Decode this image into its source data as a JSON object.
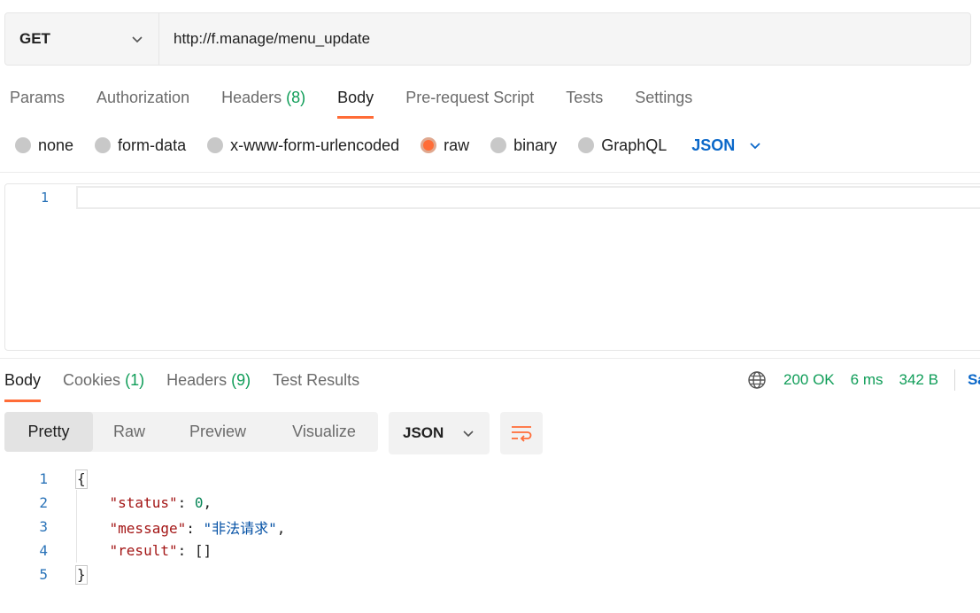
{
  "request": {
    "method": "GET",
    "url": "http://f.manage/menu_update"
  },
  "request_tabs": [
    {
      "label": "Params"
    },
    {
      "label": "Authorization"
    },
    {
      "label": "Headers",
      "count": "(8)"
    },
    {
      "label": "Body",
      "active": true
    },
    {
      "label": "Pre-request Script"
    },
    {
      "label": "Tests"
    },
    {
      "label": "Settings"
    }
  ],
  "body_types": {
    "none": "none",
    "form_data": "form-data",
    "urlencoded": "x-www-form-urlencoded",
    "raw": "raw",
    "binary": "binary",
    "graphql": "GraphQL",
    "format": "JSON",
    "selected": "raw"
  },
  "editor": {
    "line_number": "1"
  },
  "response_tabs": {
    "body": "Body",
    "cookies": "Cookies",
    "cookies_count": "(1)",
    "headers": "Headers",
    "headers_count": "(9)",
    "test_results": "Test Results"
  },
  "response_status": {
    "status": "200 OK",
    "time": "6 ms",
    "size": "342 B",
    "save_label": "Sa"
  },
  "view_modes": {
    "pretty": "Pretty",
    "raw": "Raw",
    "preview": "Preview",
    "visualize": "Visualize",
    "format": "JSON"
  },
  "response_body": {
    "line_numbers": [
      "1",
      "2",
      "3",
      "4",
      "5"
    ],
    "open_brace": "{",
    "close_brace": "}",
    "status_key": "\"status\"",
    "status_value": "0",
    "message_key": "\"message\"",
    "message_value": "\"非法请求\"",
    "result_key": "\"result\"",
    "result_value": "[]"
  },
  "colors": {
    "accent": "#ff6c37",
    "success": "#0f9d58",
    "link": "#0b68c9"
  }
}
